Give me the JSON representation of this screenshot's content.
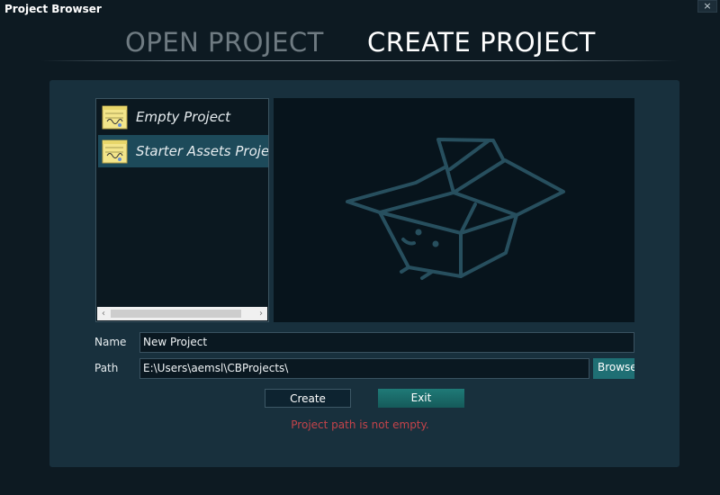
{
  "window": {
    "title": "Project Browser",
    "close_icon": "×"
  },
  "tabs": [
    {
      "label": "OPEN PROJECT",
      "active": false
    },
    {
      "label": "CREATE PROJECT",
      "active": true
    }
  ],
  "templates": [
    {
      "label": "Empty Project",
      "icon": "project-note-icon",
      "selected": false
    },
    {
      "label": "Starter Assets Project",
      "icon": "project-note-icon",
      "selected": true
    }
  ],
  "scrollbar": {
    "left_arrow": "‹",
    "right_arrow": "›"
  },
  "preview": {
    "illustration": "open-box-icon"
  },
  "form": {
    "name_label": "Name",
    "name_value": "New Project",
    "path_label": "Path",
    "path_value": "E:\\Users\\aemsl\\CBProjects\\",
    "browse_label": "Browse"
  },
  "buttons": {
    "create": "Create",
    "exit": "Exit"
  },
  "status": {
    "error": "Project path is not empty."
  },
  "colors": {
    "accent": "#1f6f74",
    "error": "#c4434a",
    "selected": "#1d4a5a",
    "panel": "#18303d"
  }
}
